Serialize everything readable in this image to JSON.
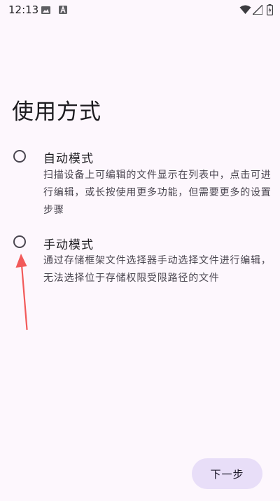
{
  "status_bar": {
    "time": "12:13",
    "icons": [
      "gallery-icon",
      "a-icon",
      "wifi-icon",
      "signal-icon",
      "battery-charging-icon"
    ]
  },
  "title": "使用方式",
  "options": [
    {
      "title": "自动模式",
      "description": "扫描设备上可编辑的文件显示在列表中，点击可进行编辑，或长按使用更多功能，但需要更多的设置步骤",
      "selected": false
    },
    {
      "title": "手动模式",
      "description": "通过存储框架文件选择器手动选择文件进行编辑，无法选择位于存储权限受限路径的文件",
      "selected": false
    }
  ],
  "next_button_label": "下一步",
  "colors": {
    "background": "#fdf7fd",
    "button_bg": "#e8def8",
    "annotation_arrow": "#f25a5a"
  }
}
